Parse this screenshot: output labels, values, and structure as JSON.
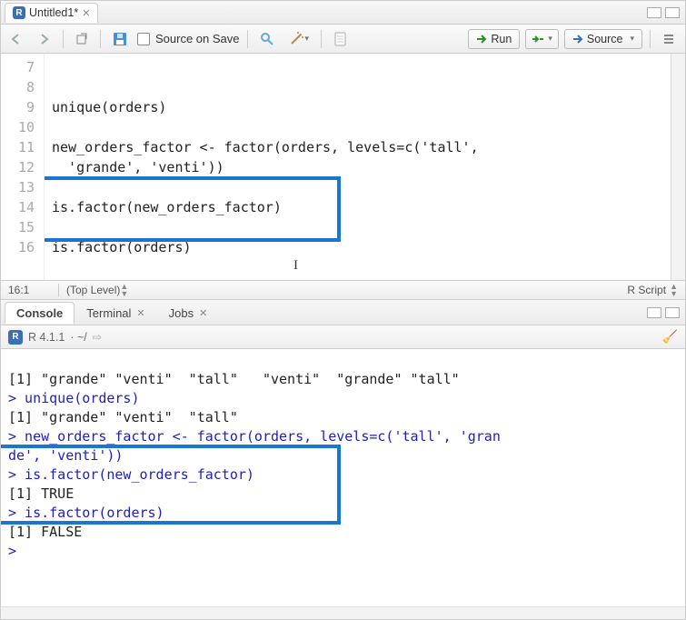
{
  "tab": {
    "title": "Untitled1*",
    "icon_letter": "R"
  },
  "toolbar": {
    "source_on_save": "Source on Save",
    "run": "Run",
    "source": "Source"
  },
  "editor": {
    "lines": {
      "7": "",
      "8": "unique(orders)",
      "9": "",
      "10": "new_orders_factor <- factor(orders, levels=c('tall',",
      "10b": "  'grande', 'venti'))",
      "11": "",
      "12": "is.factor(new_orders_factor)",
      "13": "",
      "14": "is.factor(orders)",
      "15": "",
      "16": ""
    },
    "gutter": [
      "7",
      "8",
      "9",
      "10",
      "",
      "11",
      "12",
      "13",
      "14",
      "15",
      "16"
    ]
  },
  "status": {
    "position": "16:1",
    "scope": "(Top Level)",
    "filetype": "R Script"
  },
  "console_tabs": {
    "console": "Console",
    "terminal": "Terminal",
    "jobs": "Jobs"
  },
  "console_header": {
    "version": "R 4.1.1",
    "path": "· ~/"
  },
  "console_lines": {
    "l1": "[1] \"grande\" \"venti\"  \"tall\"   \"venti\"  \"grande\" \"tall\"",
    "l2": "> unique(orders)",
    "l3": "[1] \"grande\" \"venti\"  \"tall\"",
    "l4": "> new_orders_factor <- factor(orders, levels=c('tall', 'gran",
    "l4b": "de', 'venti'))",
    "l5": "> is.factor(new_orders_factor)",
    "l6": "[1] TRUE",
    "l7": "> is.factor(orders)",
    "l8": "[1] FALSE",
    "l9": ">"
  }
}
